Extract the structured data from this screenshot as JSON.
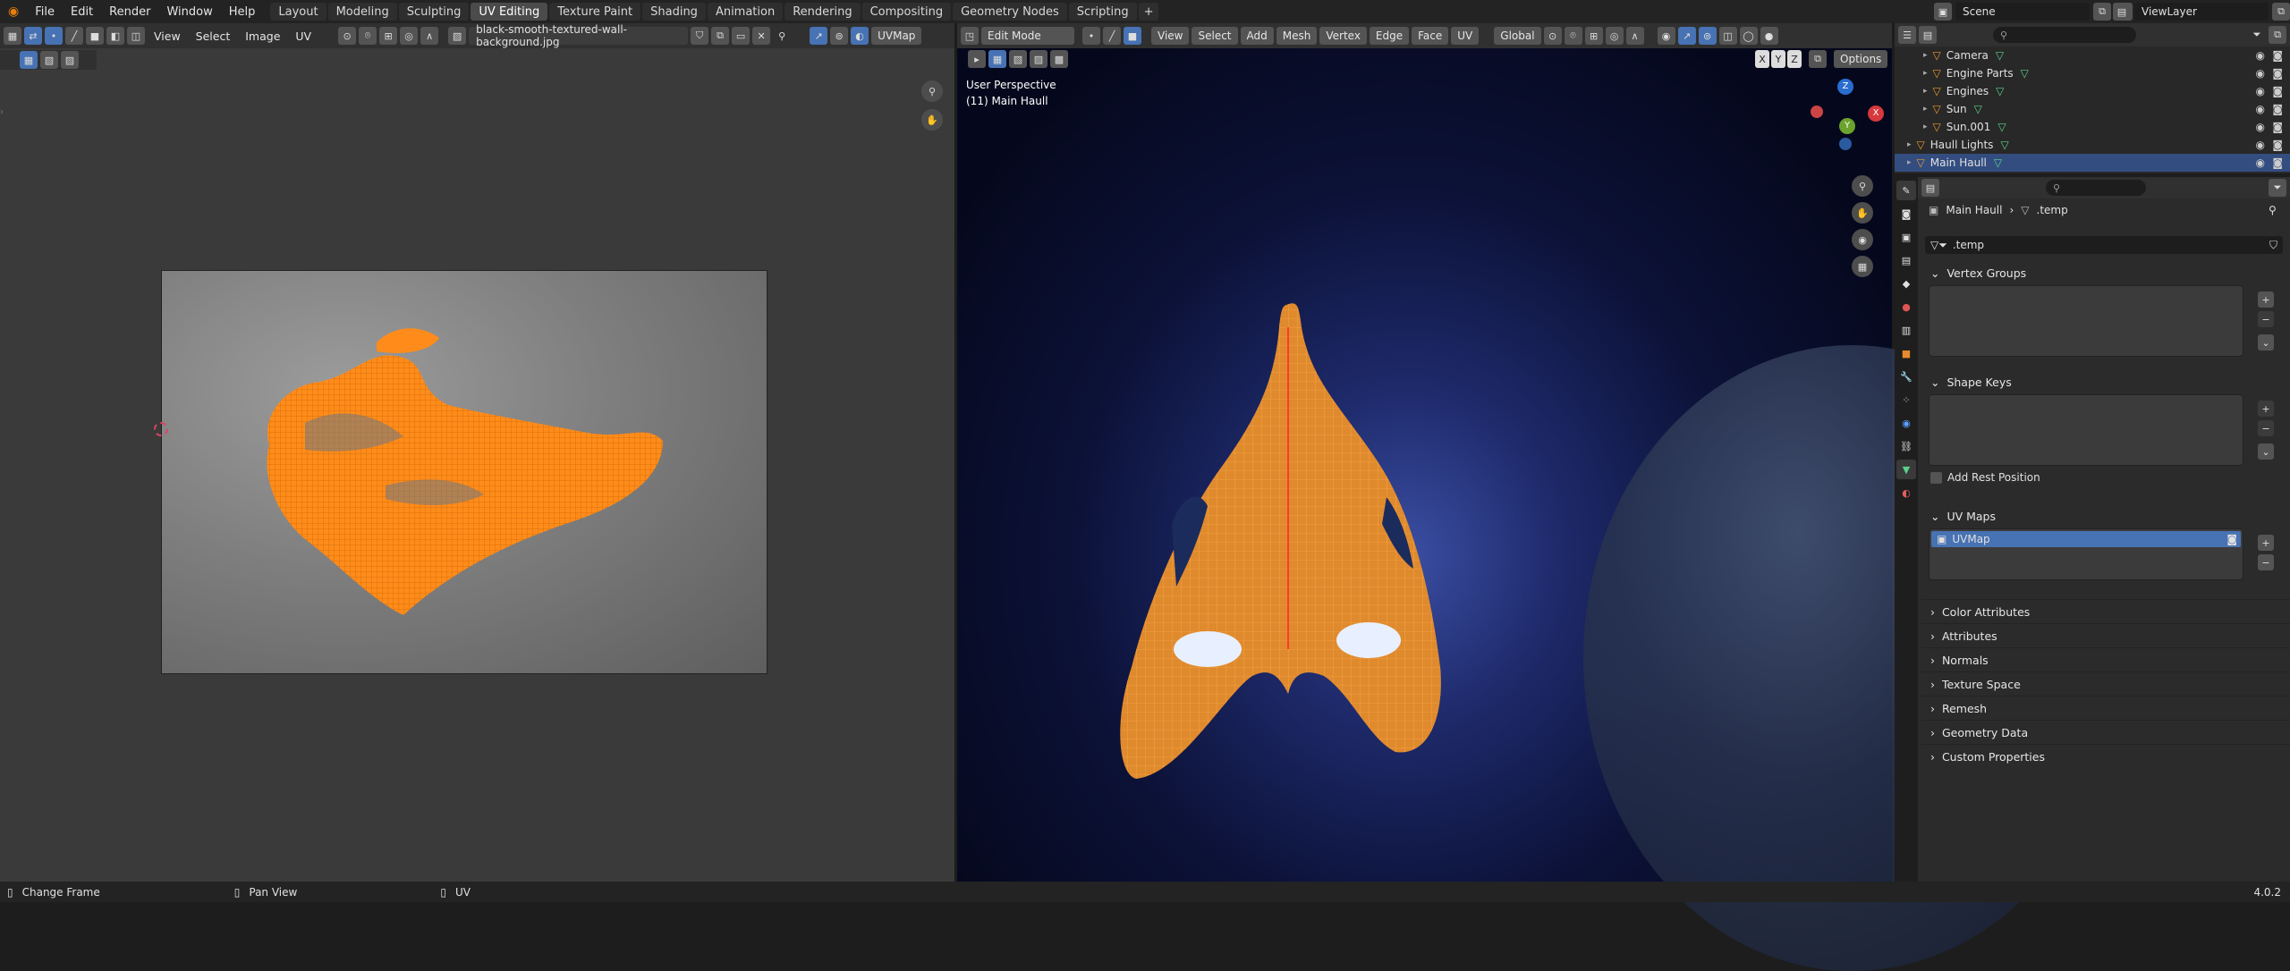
{
  "app": {
    "version": "4.0.2"
  },
  "topbar": {
    "menus": [
      "File",
      "Edit",
      "Render",
      "Window",
      "Help"
    ],
    "tabs": [
      "Layout",
      "Modeling",
      "Sculpting",
      "UV Editing",
      "Texture Paint",
      "Shading",
      "Animation",
      "Rendering",
      "Compositing",
      "Geometry Nodes",
      "Scripting"
    ],
    "active_tab": "UV Editing",
    "add_tab": "+",
    "scene": "Scene",
    "view_layer": "ViewLayer"
  },
  "uv_editor": {
    "menus": [
      "View",
      "Select",
      "Image",
      "UV"
    ],
    "image_name": "black-smooth-textured-wall-background.jpg",
    "uv_map": "UVMap"
  },
  "viewport": {
    "mode": "Edit Mode",
    "menus": [
      "View",
      "Select",
      "Add",
      "Mesh",
      "Vertex",
      "Edge",
      "Face",
      "UV"
    ],
    "orientation": "Global",
    "perspective": "User Perspective",
    "object_info": "(11) Main Haull",
    "axes": [
      "X",
      "Y",
      "Z"
    ],
    "options": "Options",
    "gizmo": {
      "x": "X",
      "y": "Y",
      "z": "Z"
    }
  },
  "outliner": {
    "items": [
      {
        "label": "Camera",
        "icon": "camera-icon"
      },
      {
        "label": "Engine Parts",
        "icon": "mesh-icon"
      },
      {
        "label": "Engines",
        "icon": "mesh-icon"
      },
      {
        "label": "Sun",
        "icon": "light-icon"
      },
      {
        "label": "Sun.001",
        "icon": "light-icon"
      },
      {
        "label": "Haull Lights",
        "icon": "mesh-icon"
      },
      {
        "label": "Main Haull",
        "icon": "mesh-icon",
        "selected": true
      }
    ]
  },
  "properties": {
    "breadcrumb_object": "Main Haull",
    "breadcrumb_data": ".temp",
    "data_name": ".temp",
    "panels": {
      "vertex_groups": "Vertex Groups",
      "shape_keys": "Shape Keys",
      "add_rest_position": "Add Rest Position",
      "uv_maps": "UV Maps",
      "uv_map_item": "UVMap"
    },
    "collapsed_panels": [
      "Color Attributes",
      "Attributes",
      "Normals",
      "Texture Space",
      "Remesh",
      "Geometry Data",
      "Custom Properties"
    ]
  },
  "statusbar": {
    "items": [
      "Change Frame",
      "Pan View",
      "UV"
    ],
    "version": "4.0.2"
  },
  "colors": {
    "accent": "#4772b3",
    "mesh_orange": "#ff8c1a",
    "selection": "#334d80"
  }
}
